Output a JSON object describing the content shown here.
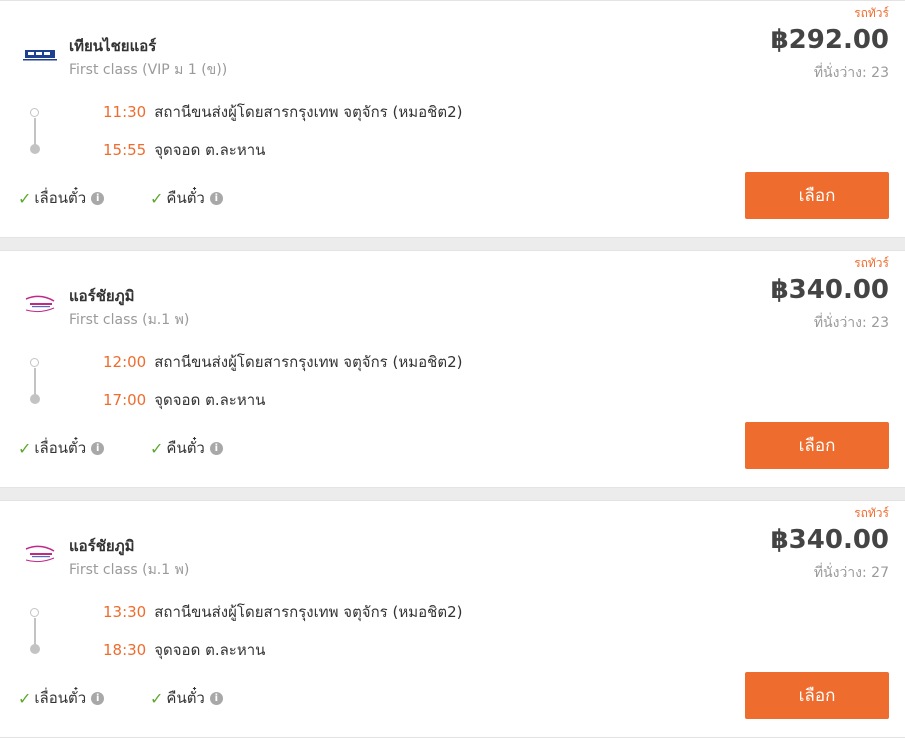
{
  "trips": [
    {
      "tag": "รถทัวร์",
      "logo_icon": "bus-company-logo-blue",
      "operator": "เทียนไชยแอร์",
      "class": "First class (VIP ม 1 (ข))",
      "price": "฿292.00",
      "seats": "ที่นั่งว่าง: 23",
      "departure": {
        "time": "11:30",
        "place": "สถานีขนส่งผู้โดยสารกรุงเทพ จตุจักร (หมอชิต2)"
      },
      "arrival": {
        "time": "15:55",
        "place": "จุดจอด ต.ละหาน"
      },
      "feature1": "เลื่อนตั๋ว",
      "feature2": "คืนตั๋ว",
      "select_label": "เลือก"
    },
    {
      "tag": "รถทัวร์",
      "logo_icon": "bus-company-logo-pink",
      "operator": "แอร์ชัยภูมิ",
      "class": "First class (ม.1 พ)",
      "price": "฿340.00",
      "seats": "ที่นั่งว่าง: 23",
      "departure": {
        "time": "12:00",
        "place": "สถานีขนส่งผู้โดยสารกรุงเทพ จตุจักร (หมอชิต2)"
      },
      "arrival": {
        "time": "17:00",
        "place": "จุดจอด ต.ละหาน"
      },
      "feature1": "เลื่อนตั๋ว",
      "feature2": "คืนตั๋ว",
      "select_label": "เลือก"
    },
    {
      "tag": "รถทัวร์",
      "logo_icon": "bus-company-logo-pink",
      "operator": "แอร์ชัยภูมิ",
      "class": "First class (ม.1 พ)",
      "price": "฿340.00",
      "seats": "ที่นั่งว่าง: 27",
      "departure": {
        "time": "13:30",
        "place": "สถานีขนส่งผู้โดยสารกรุงเทพ จตุจักร (หมอชิต2)"
      },
      "arrival": {
        "time": "18:30",
        "place": "จุดจอด ต.ละหาน"
      },
      "feature1": "เลื่อนตั๋ว",
      "feature2": "คืนตั๋ว",
      "select_label": "เลือก"
    }
  ],
  "colors": {
    "accent": "#ee6c2e",
    "check": "#5ea82f",
    "muted": "#9a9a9a"
  }
}
